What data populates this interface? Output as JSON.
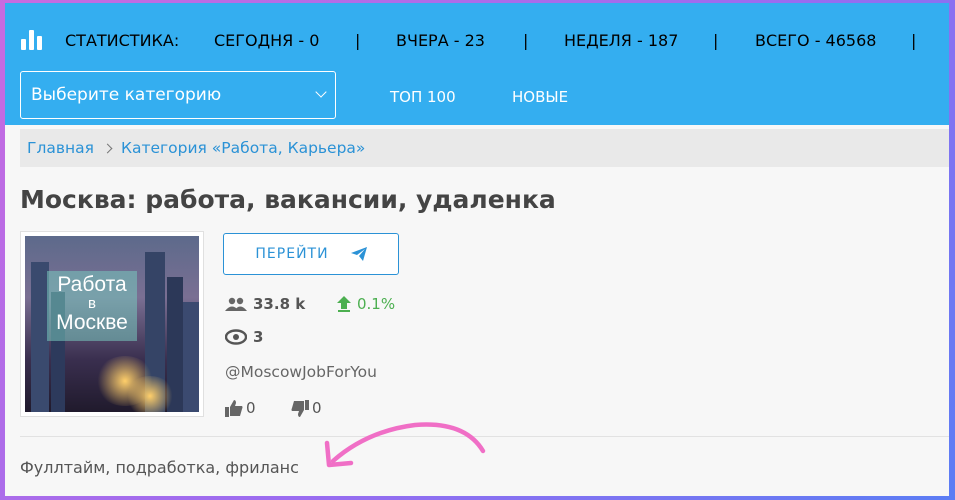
{
  "header": {
    "stats_title": "СТАТИСТИКА:",
    "stats": [
      {
        "label": "СЕГОДНЯ - 0"
      },
      {
        "label": "ВЧЕРА - 23"
      },
      {
        "label": "НЕДЕЛЯ - 187"
      },
      {
        "label": "ВСЕГО - 46568"
      }
    ],
    "separator": "|",
    "category_select": "Выберите категорию",
    "nav": [
      "ТОП 100",
      "НОВЫЕ"
    ]
  },
  "breadcrumb": {
    "home": "Главная",
    "category": "Категория «Работа, Карьера»"
  },
  "channel": {
    "title": "Москва: работа, вакансии, удаленка",
    "thumbnail_text": [
      "Работа",
      "в",
      "Москве"
    ],
    "go_button": "ПЕРЕЙТИ",
    "subscribers": "33.8 k",
    "growth": "0.1%",
    "views": "3",
    "handle": "@MoscowJobForYou",
    "likes": "0",
    "dislikes": "0",
    "description": "Фуллтайм, подработка, фриланс"
  },
  "colors": {
    "header_bg": "#34aef0",
    "link": "#2b92d6",
    "growth": "#4caf50",
    "annotation_arrow": "#f06fc6"
  }
}
